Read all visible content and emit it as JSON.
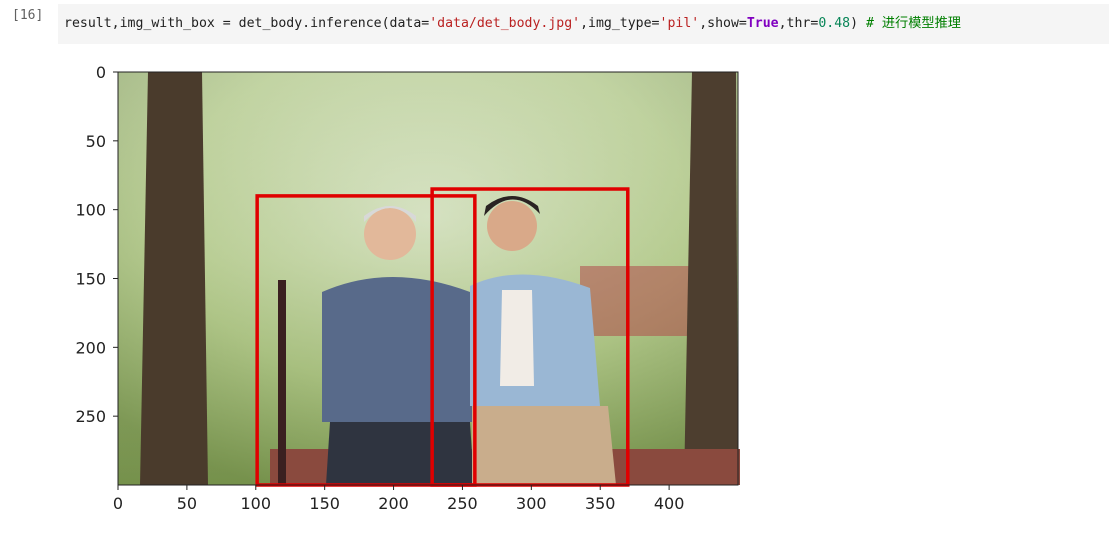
{
  "cell": {
    "prompt": "[16]",
    "code": {
      "segments": [
        {
          "text": "result,img_with_box = det_body.inference(data=",
          "cls": ""
        },
        {
          "text": "'data/det_body.jpg'",
          "cls": "tok-str"
        },
        {
          "text": ",img_type=",
          "cls": ""
        },
        {
          "text": "'pil'",
          "cls": "tok-str"
        },
        {
          "text": ",show=",
          "cls": ""
        },
        {
          "text": "True",
          "cls": "tok-kw"
        },
        {
          "text": ",thr=",
          "cls": ""
        },
        {
          "text": "0.48",
          "cls": "tok-num"
        },
        {
          "text": ") ",
          "cls": ""
        },
        {
          "text": "# 进行模型推理",
          "cls": "tok-comment"
        }
      ]
    }
  },
  "output_plot": {
    "x_ticks": [
      "0",
      "50",
      "100",
      "150",
      "200",
      "250",
      "300",
      "350",
      "400"
    ],
    "y_ticks": [
      "0",
      "50",
      "100",
      "150",
      "200",
      "250"
    ],
    "xlim": [
      0,
      450
    ],
    "ylim": [
      300,
      0
    ],
    "boxes": [
      {
        "x1": 101,
        "y1": 90,
        "x2": 259,
        "y2": 300,
        "color": "#e00000"
      },
      {
        "x1": 228,
        "y1": 85,
        "x2": 370,
        "y2": 300,
        "color": "#e00000"
      }
    ]
  }
}
